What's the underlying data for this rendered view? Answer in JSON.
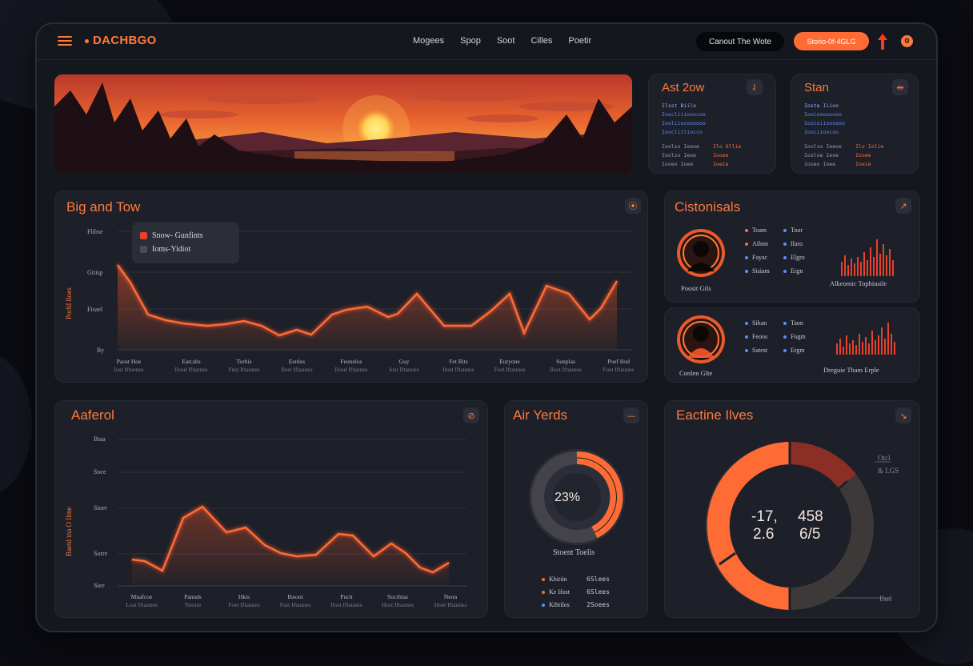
{
  "app": {
    "logo": "DACHBGO"
  },
  "nav": [
    "Mogees",
    "Spop",
    "Soot",
    "Cilles",
    "Poetir"
  ],
  "header": {
    "dark_button": "Canout The Wote",
    "orange_button": "Storio-0f-4GLG",
    "notif_count": "0"
  },
  "stats_cards": [
    {
      "title": "Ast 2ow",
      "icon": "⇃",
      "rows": [
        "Ilsst Biilo",
        "Ioocliiiooocoo",
        "Iooliiocoooooo",
        "Ioocliiliocco",
        "Ioolss Ieeoe",
        "Ioolss Ieoe",
        "Iooeo Ioee"
      ],
      "values": [
        "Ilo Ollie",
        "Iooee",
        "Ioeie"
      ]
    },
    {
      "title": "Stan",
      "icon": "⇹",
      "rows": [
        "Ioste Iiioo",
        "Iooioooooooo",
        "Iooioiioooooo",
        "Iooiiioocoo",
        "Ioolso Ieeoe",
        "Iooloe Ieoe",
        "Iooeo Ioee"
      ],
      "values": [
        "Ilo Iolie",
        "Iooee",
        "Ioeie"
      ]
    }
  ],
  "big_chart": {
    "title": "Big and Tow",
    "icon": "⦿",
    "y_title": "Porfd Iloes",
    "y_ticks": [
      "Flibse",
      "Gtiisp",
      "Fisael",
      "Ry"
    ],
    "legend": [
      {
        "label": "Snow- Gunfints",
        "color": "#e8402a"
      },
      {
        "label": "Ioms-Yidiot",
        "color": "#4a4d57"
      }
    ],
    "x_labels": [
      {
        "top": "Paost Hoe",
        "sub": "Iost Iftoenes"
      },
      {
        "top": "Eatcabs",
        "sub": "Ilosd Iftaunes"
      },
      {
        "top": "Torhis",
        "sub": "Fnst Iftaunes"
      },
      {
        "top": "Eenlos",
        "sub": "Ilost Iftaunes"
      },
      {
        "top": "Feunelos",
        "sub": "Ilosd Iftaunes"
      },
      {
        "top": "Guy",
        "sub": "Iost Iftaunes"
      },
      {
        "top": "Fet Rits",
        "sub": "Itost Iftaunes"
      },
      {
        "top": "Euryone",
        "sub": "Fost Iftaunes"
      },
      {
        "top": "Sunplas",
        "sub": "Ilost Iftaunes"
      },
      {
        "top": "Poef Ilod",
        "sub": "Fost Iftaunes"
      }
    ]
  },
  "customers": {
    "title": "Cistonisals",
    "icon": "↗",
    "panels": [
      {
        "avatar_caption": "Poosit Gils",
        "items_left": [
          "Toam",
          "Aihnn",
          "Fayac",
          "Sisiam"
        ],
        "items_right": [
          "Toor",
          "Ilaro",
          "Elgro",
          "Ergn"
        ],
        "bars_caption": "Alkeomic Tophiusile"
      },
      {
        "avatar_caption": "Conlen Glte",
        "items_left": [
          "Sihan",
          "Feoos",
          "Satest"
        ],
        "items_right": [
          "Taon",
          "Fogm",
          "Ergm"
        ],
        "bars_caption": "Dreguie  Tham Erple"
      }
    ]
  },
  "lower_chart": {
    "title": "Aaferol",
    "icon": "⊘",
    "y_title": "Baetd tna O Ilme",
    "y_ticks": [
      "Btaa",
      "Soce",
      "Sioer",
      "Sorre",
      "Siee"
    ],
    "x_labels": [
      {
        "top": "Mnafcoe",
        "sub": "Lost Iftaunes"
      },
      {
        "top": "Pannds",
        "sub": "Tostire"
      },
      {
        "top": "Hkis",
        "sub": "Foet Iftaunes"
      },
      {
        "top": "Iheoot",
        "sub": "Fast Iftaunes"
      },
      {
        "top": "Pucit",
        "sub": "Ilost Iftaunes"
      },
      {
        "top": "Socrbias",
        "sub": "Host Iftaunes"
      },
      {
        "top": "Neon",
        "sub": "Hoet Iftaunes"
      }
    ]
  },
  "air_yards": {
    "title": "Air Yerds",
    "icon": "—",
    "center_label": "23%",
    "caption": "Stoent Toelis",
    "legend": [
      {
        "label": "Khitiin",
        "value": "6Slees"
      },
      {
        "label": "Ke Ifost",
        "value": "6Slees"
      },
      {
        "label": "Kihtilos",
        "value": "2Soees"
      }
    ]
  },
  "eactine": {
    "title": "Eactine Ilves",
    "icon": "↘",
    "values": [
      "-17,",
      "458",
      "2.6",
      "6/5"
    ],
    "callout_top": [
      "Otcl",
      "& LGS"
    ],
    "callout_bottom": "Ilsel"
  },
  "colors": {
    "accent": "#ff6b35",
    "card": "#1d2029",
    "bg": "#0b0c12"
  }
}
